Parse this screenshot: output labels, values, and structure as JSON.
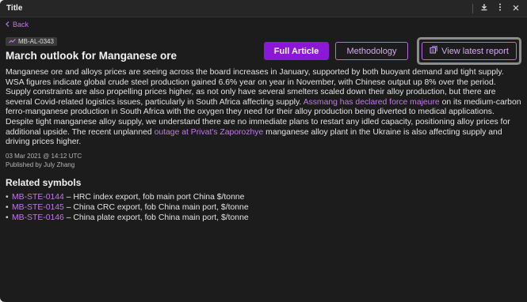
{
  "window": {
    "title": "Title"
  },
  "nav": {
    "back_label": "Back"
  },
  "article": {
    "tag": "MB-AL-0343",
    "headline": "March outlook for Manganese ore",
    "buttons": {
      "full_article": "Full Article",
      "methodology": "Methodology",
      "view_latest_report": "View latest report"
    },
    "body": {
      "p1": "Manganese ore and alloys prices are seeing across the board increases in January, supported by both buoyant demand and tight supply. WSA figures indicate global crude steel production gained 6.6% year on year in November, with Chinese output up 8% over the period. Supply constraints are also propelling prices higher, as not only have several smelters scaled down their alloy production, but there are several Covid-related logistics issues, particularly in South Africa affecting supply. ",
      "link1": "Assmang has declared force majeure",
      "p2": " on its medium-carbon ferro-manganese production in South Africa with the oxygen they need for their alloy production being diverted to medical applications. Despite tight manganese alloy supply, we understand there are no immediate plans to restart any idled capacity, positioning alloy prices for additional upside. The recent unplanned ",
      "link2": "outage at Privat's Zaporozhye",
      "p3": " manganese alloy plant in the Ukraine is also affecting supply and driving prices higher."
    },
    "date": "03 Mar 2021 @ 14:12 UTC",
    "published_by": "Published by July Zhang"
  },
  "related": {
    "title": "Related symbols",
    "items": [
      {
        "symbol": "MB-STE-0144",
        "desc": " – HRC index export, fob main port China $/tonne"
      },
      {
        "symbol": "MB-STE-0145",
        "desc": " – China CRC export, fob China main port, $/tonne"
      },
      {
        "symbol": "MB-STE-0146",
        "desc": " – China plate export, fob China main port, $/tonne"
      }
    ]
  },
  "icons": {
    "download": "download-icon",
    "more": "more-vertical-icon",
    "close": "close-icon",
    "back": "chevron-left-icon",
    "trend": "trend-line-icon",
    "report": "report-icon"
  },
  "colors": {
    "accent": "#8a18d6",
    "link": "#c07ae8",
    "background": "#1c1c1c"
  }
}
